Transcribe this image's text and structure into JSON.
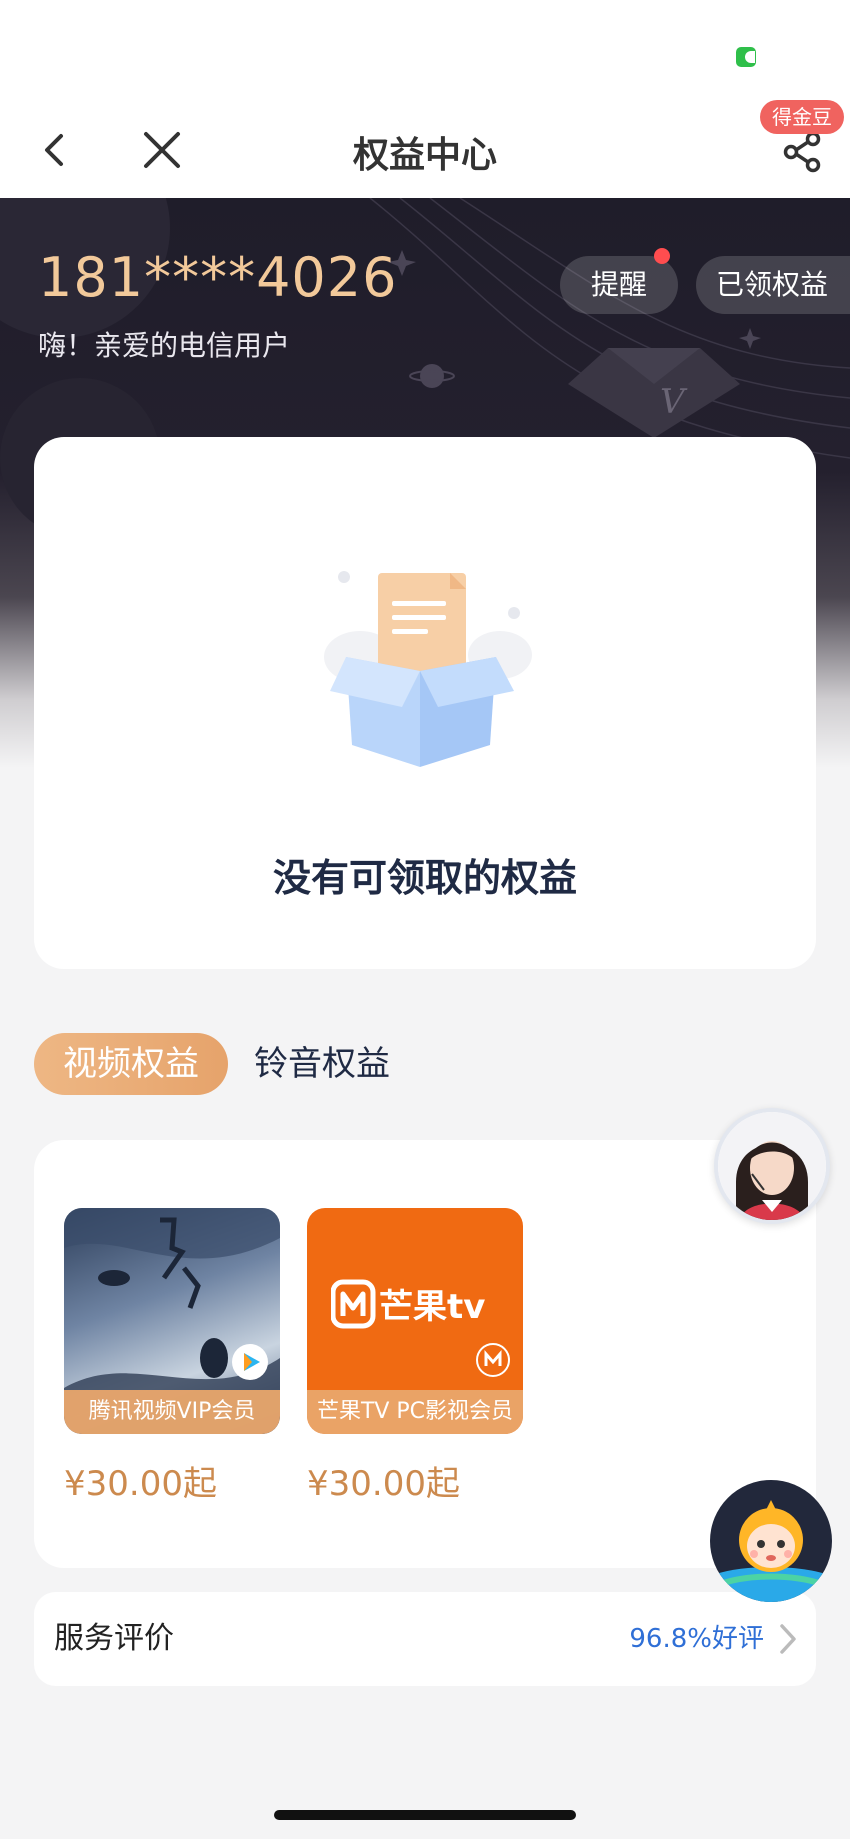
{
  "nav": {
    "title": "权益中心",
    "coin_badge": "得金豆"
  },
  "header": {
    "phone_number": "181****4026",
    "greeting": "嗨！亲爱的电信用户",
    "remind_label": "提醒",
    "claimed_label": "已领权益"
  },
  "empty_state": {
    "message": "没有可领取的权益"
  },
  "tabs": [
    {
      "label": "视频权益",
      "active": true
    },
    {
      "label": "铃音权益",
      "active": false
    }
  ],
  "products": [
    {
      "label": "腾讯视频VIP会员",
      "price": "¥30.00起",
      "logo": "tencent-video"
    },
    {
      "label": "芒果TV PC影视会员",
      "price": "¥30.00起",
      "logo_text": "芒果tv"
    }
  ],
  "rating": {
    "label": "服务评价",
    "value": "96.8%好评"
  },
  "colors": {
    "accent": "#e6a36b",
    "header_bg": "#1f1d2a",
    "phone_gold": "#f2c99a",
    "link_blue": "#2f6fd6",
    "mango_orange": "#f06a12",
    "badge_red": "#f0635f"
  }
}
